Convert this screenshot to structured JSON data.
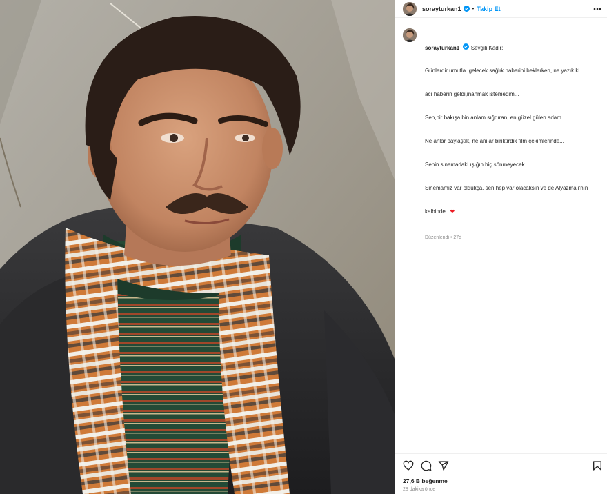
{
  "post": {
    "username": "sorayturkan1",
    "follow_label": "Takip Et",
    "separator": "•",
    "caption_lines": [
      "Sevgili Kadir;",
      "Günlerdir umutla ,gelecek sağlık haberini beklerken, ne yazık ki",
      "acı haberin geldi,inanmak istemedim...",
      "Sen,bir bakışa bin anlam sığdıran, en güzel gülen adam...",
      "Ne anlar paylaştık, ne anılar biriktirdik film çekimlerinde...",
      "Senin sinemadaki ışığın hiç sönmeyecek.",
      "Sinemamız var oldukça, sen hep var olacaksın ve de Alyazmalı'nın",
      "kalbinde..."
    ],
    "caption_emoji": "❤",
    "edited_label": "Düzenlendi",
    "edited_age": "27d",
    "likes": "27,6 B beğenme",
    "posted_ago": "28 dakika önce"
  },
  "icons": {
    "verified": "verified-badge-icon",
    "more": "more-options-icon",
    "like": "heart-icon",
    "comment": "comment-icon",
    "share": "share-icon",
    "save": "bookmark-icon"
  },
  "colors": {
    "accent": "#0095f6",
    "heart": "#ed1c24",
    "muted": "#8e8e8e",
    "text": "#262626"
  }
}
